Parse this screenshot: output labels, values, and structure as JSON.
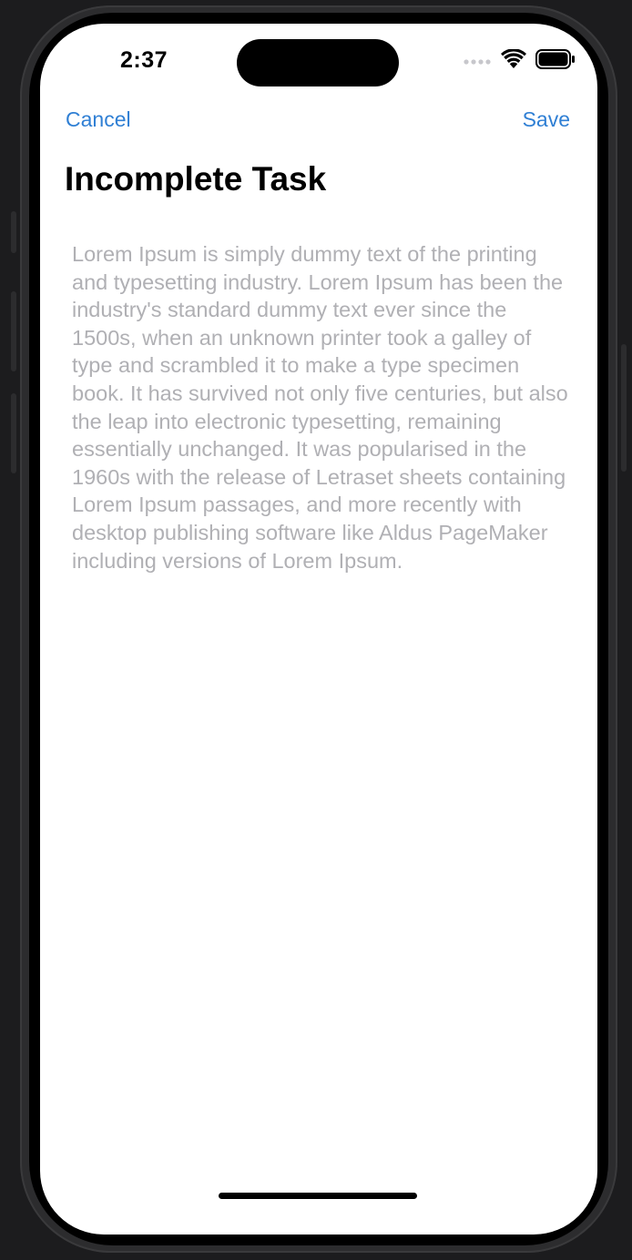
{
  "status_bar": {
    "time": "2:37"
  },
  "nav": {
    "cancel_label": "Cancel",
    "save_label": "Save"
  },
  "page": {
    "title": "Incomplete Task",
    "description": "Lorem Ipsum is simply dummy text of the printing and typesetting industry. Lorem Ipsum has been the industry's standard dummy text ever since the 1500s, when an unknown printer took a galley of type and scrambled it to make a type specimen book. It has survived not only five centuries, but also the leap into electronic typesetting, remaining essentially unchanged. It was popularised in the 1960s with the release of Letraset sheets containing Lorem Ipsum passages, and more recently with desktop publishing software like Aldus PageMaker including versions of Lorem Ipsum."
  },
  "icons": {
    "cellular": "cellular-signal-icon",
    "wifi": "wifi-icon",
    "battery": "battery-icon"
  },
  "colors": {
    "accent": "#2f7fd4",
    "text_placeholder": "#b0b0b4",
    "background": "#ffffff",
    "device_frame": "#1c1c1e"
  }
}
